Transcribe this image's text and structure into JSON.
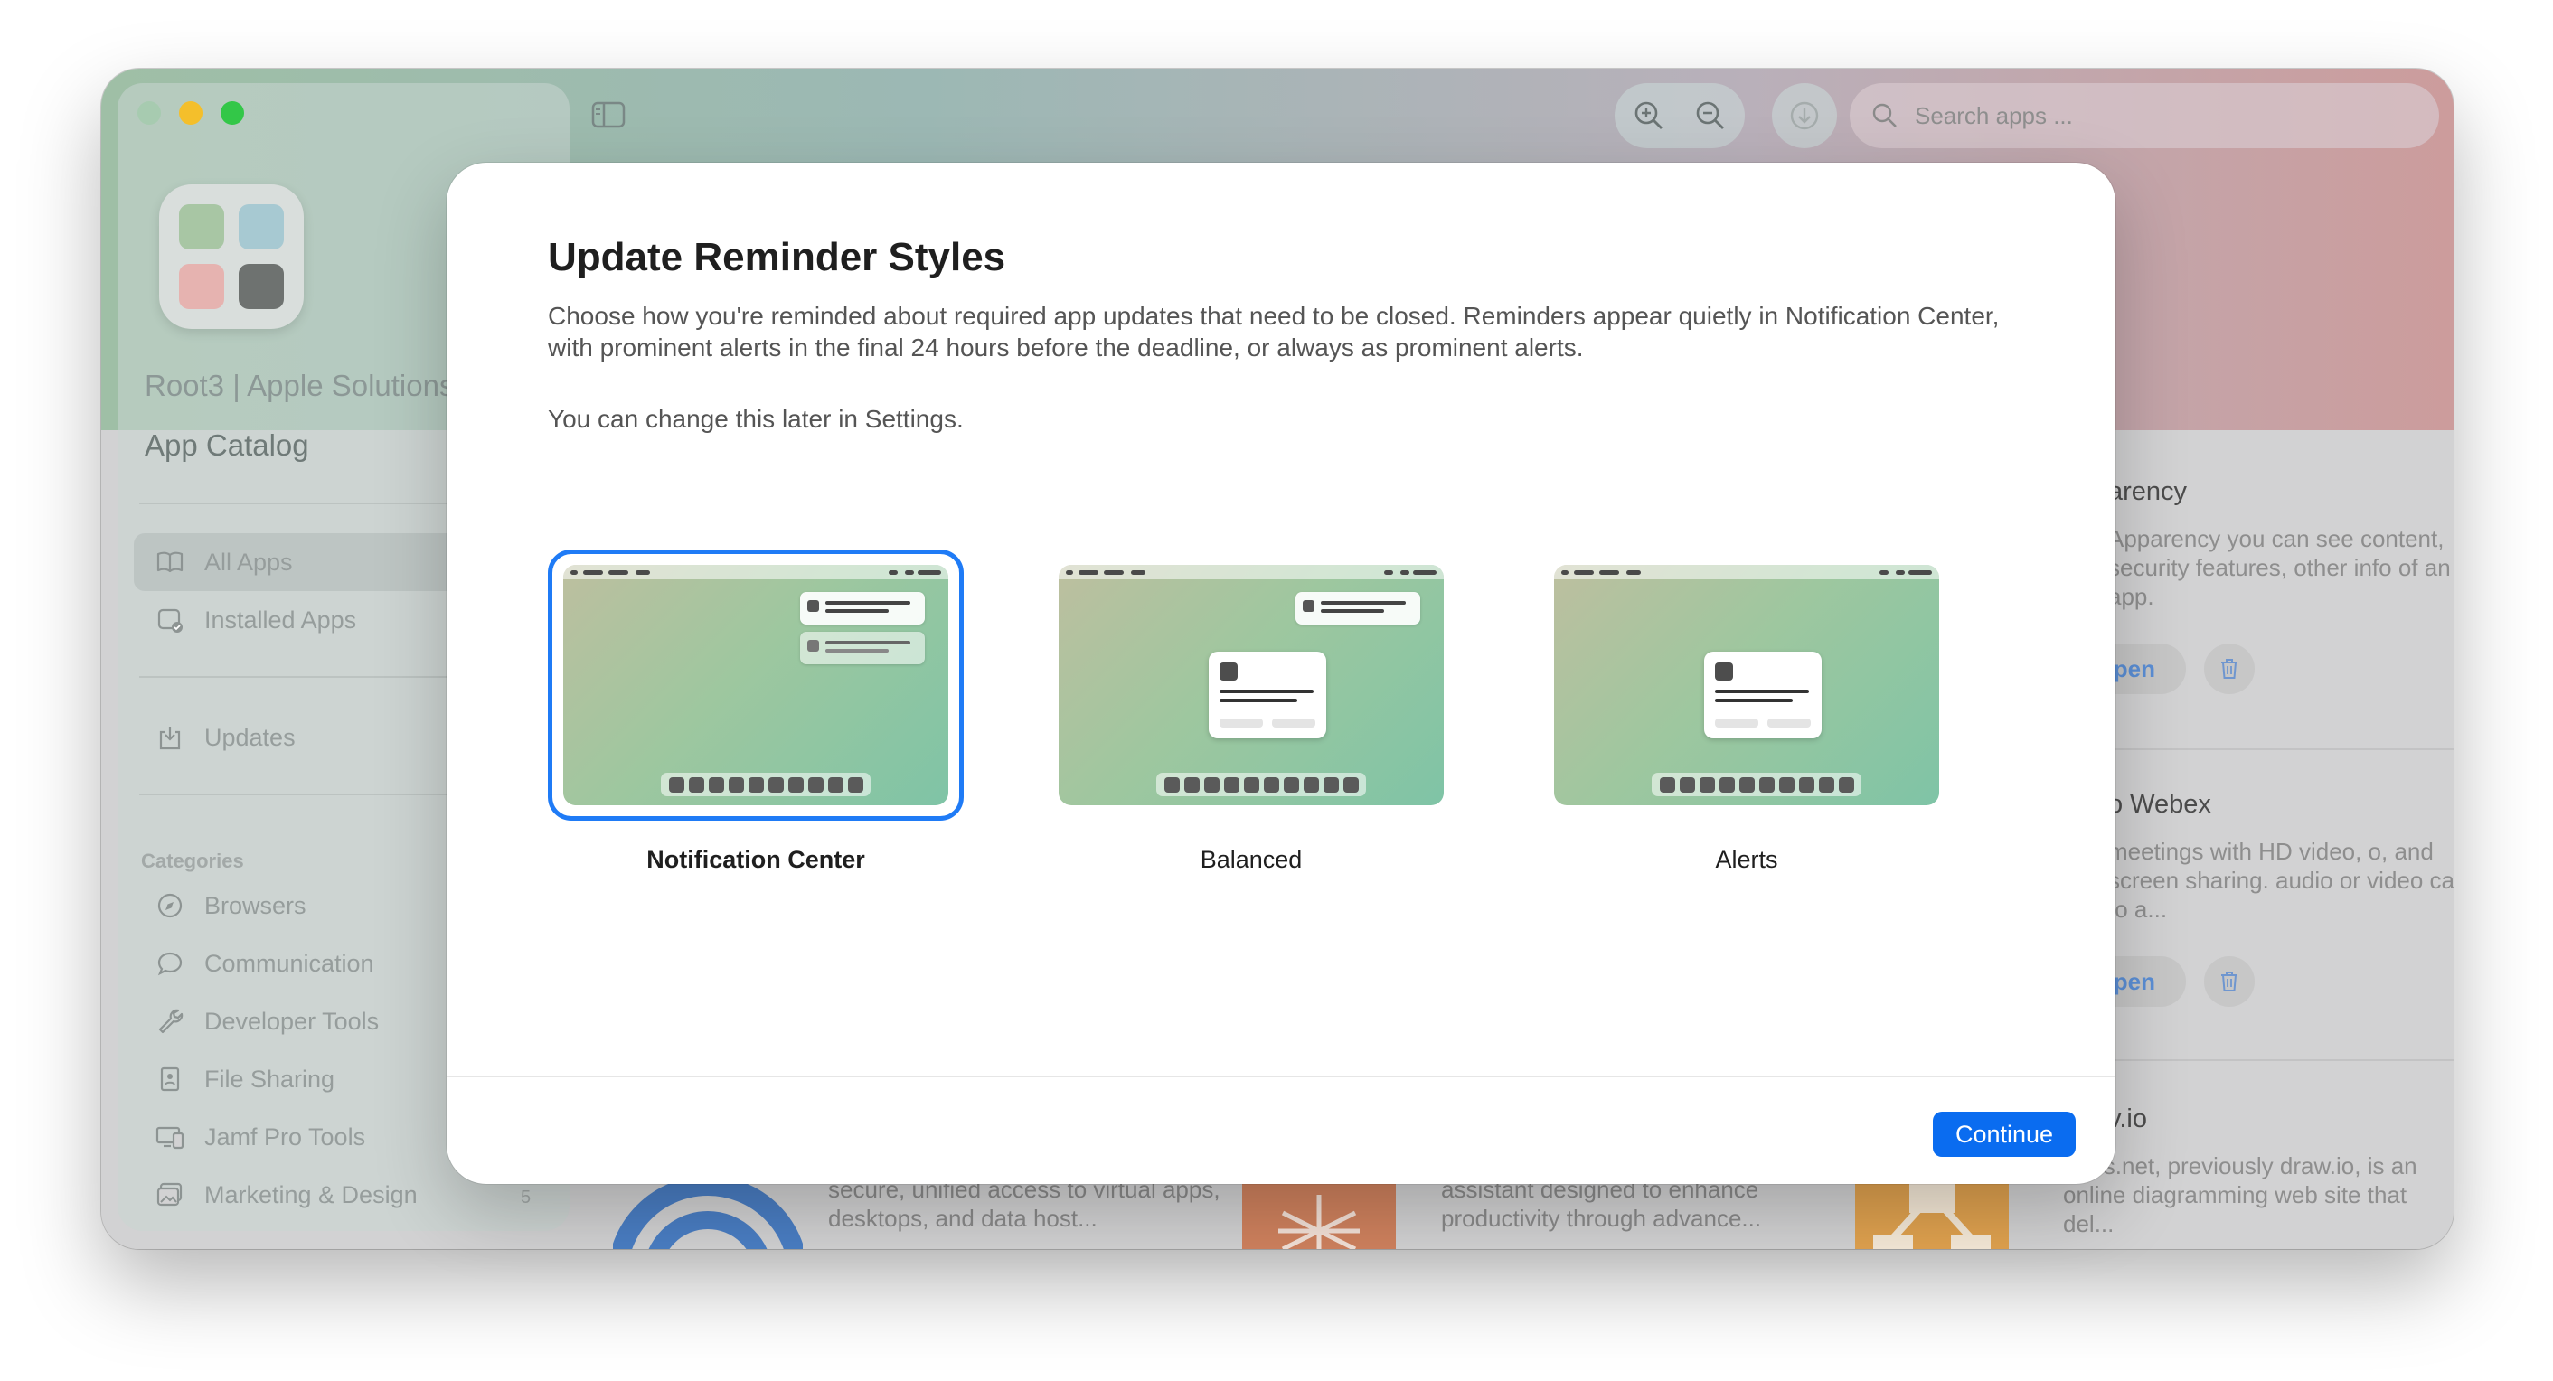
{
  "window": {
    "sidebar": {
      "org_name": "Root3 | Apple Solutions",
      "app_title": "App Catalog",
      "nav": [
        {
          "label": "All Apps",
          "icon": "book-icon"
        },
        {
          "label": "Installed Apps",
          "icon": "installed-icon"
        },
        {
          "label": "Updates",
          "icon": "updates-icon"
        }
      ],
      "categories_heading": "Categories",
      "categories": [
        {
          "label": "Browsers",
          "icon": "compass-icon"
        },
        {
          "label": "Communication",
          "icon": "chat-bubble-icon"
        },
        {
          "label": "Developer Tools",
          "icon": "wrench-icon"
        },
        {
          "label": "File Sharing",
          "icon": "file-icon"
        },
        {
          "label": "Jamf Pro Tools",
          "icon": "desktop-icon"
        },
        {
          "label": "Marketing & Design",
          "icon": "photo-icon"
        }
      ],
      "last_category_count": "5"
    },
    "toolbar": {
      "search_placeholder": "Search apps ..."
    },
    "cards": [
      {
        "title": "arency",
        "description": "Apparency you can see content, security features, other info of an app.",
        "open_label": "pen"
      },
      {
        "title": "o Webex",
        "description": "meetings with HD video, o, and screen sharing. audio or video calls to a...",
        "open_label": "pen"
      },
      {
        "title": "v.io",
        "description": "rams.net, previously draw.io, is an online diagramming web site that del..."
      }
    ],
    "bottom_row": [
      {
        "description": "secure, unified access to virtual apps, desktops, and data host..."
      },
      {
        "description": "assistant designed to enhance productivity through advance..."
      }
    ]
  },
  "modal": {
    "title": "Update Reminder Styles",
    "description": "Choose how you're reminded about required app updates that need to be closed. Reminders appear quietly in Notification Center, with prominent alerts in the final 24 hours before the deadline, or always as prominent alerts.",
    "note": "You can change this later in Settings.",
    "options": [
      {
        "label": "Notification Center",
        "selected": true
      },
      {
        "label": "Balanced",
        "selected": false
      },
      {
        "label": "Alerts",
        "selected": false
      }
    ],
    "continue_label": "Continue"
  },
  "colors": {
    "accent": "#0a6cf0",
    "selection_border": "#1f7bf6"
  }
}
